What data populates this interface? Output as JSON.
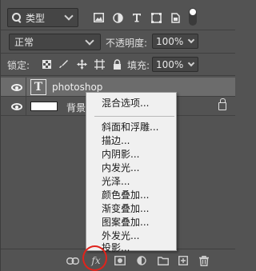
{
  "filter": {
    "kind_label": "类型"
  },
  "blend": {
    "mode_label": "正常",
    "opacity_label": "不透明度:",
    "opacity_value": "100%"
  },
  "lock": {
    "label": "锁定:",
    "fill_label": "填充:",
    "fill_value": "100%"
  },
  "layers": [
    {
      "name": "photoshop",
      "type": "text",
      "thumb_glyph": "T",
      "selected": true
    },
    {
      "name": "背景",
      "type": "background",
      "locked": true,
      "selected": false
    }
  ],
  "context_menu": {
    "items": [
      "混合选项...",
      "斜面和浮雕...",
      "描边...",
      "内阴影...",
      "内发光...",
      "光泽...",
      "颜色叠加...",
      "渐变叠加...",
      "图案叠加...",
      "外发光...",
      "投影..."
    ]
  },
  "bottom_toolbar": {
    "fx_label": "fx"
  },
  "colors": {
    "panel_bg": "#535353",
    "selected_row": "#6c6c6c",
    "menu_bg": "#f0f0f0",
    "highlight_circle": "#e0231c"
  },
  "icons": [
    "search-icon",
    "image-filter-icon",
    "adjustment-filter-icon",
    "type-filter-icon",
    "shape-filter-icon",
    "smart-object-filter-icon",
    "lock-transparent-icon",
    "lock-image-icon",
    "lock-position-icon",
    "lock-artboard-icon",
    "lock-all-icon",
    "eye-icon",
    "link-icon",
    "fx-icon",
    "mask-icon",
    "adjustment-icon",
    "folder-icon",
    "new-layer-icon",
    "trash-icon"
  ]
}
